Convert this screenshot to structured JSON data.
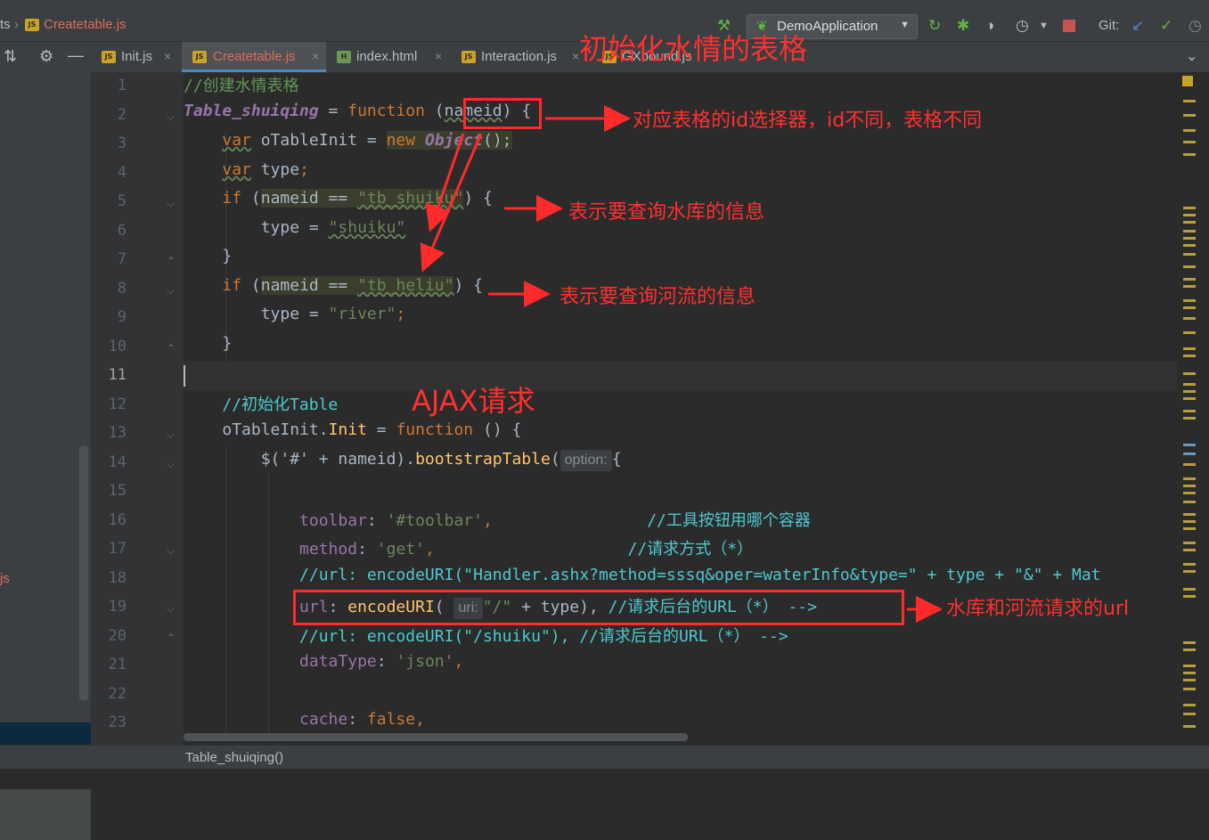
{
  "breadcrumb": {
    "prev": "ts",
    "file": "Createtable.js"
  },
  "run_config": {
    "label": "DemoApplication"
  },
  "git": {
    "label": "Git:"
  },
  "tabs": [
    {
      "label": "Init.js",
      "icon": "js-file-icon"
    },
    {
      "label": "Createtable.js",
      "icon": "js-file-icon",
      "active": true
    },
    {
      "label": "index.html",
      "icon": "html-file-icon"
    },
    {
      "label": "Interaction.js",
      "icon": "js-file-icon"
    },
    {
      "label": "GXbound.js",
      "icon": "js-file-icon"
    }
  ],
  "sidebar": {
    "file_fragment": "js"
  },
  "editor": {
    "line_numbers": [
      "1",
      "2",
      "3",
      "4",
      "5",
      "6",
      "7",
      "8",
      "9",
      "10",
      "11",
      "12",
      "13",
      "14",
      "15",
      "16",
      "17",
      "18",
      "19",
      "20",
      "21",
      "22",
      "23"
    ],
    "current_line": 11,
    "lines": {
      "l1": {
        "c": "//创建水情表格"
      },
      "l2": {
        "a": "Table_shuiqing",
        "b": " = ",
        "c": "function",
        "d": " (",
        "e": "nameid",
        "f": ") {"
      },
      "l3": {
        "a": "var",
        "b": " oTableInit = ",
        "c": "new ",
        "d": "Object",
        "e": "();"
      },
      "l4": {
        "a": "var",
        "b": " type",
        "c": ";"
      },
      "l5": {
        "a": "if",
        "b": " (",
        "c": "nameid == ",
        "d": "\"tb_shuiku\"",
        "e": ") {"
      },
      "l6": {
        "a": "type = ",
        "b": "\"shuiku\""
      },
      "l7": {
        "a": "}"
      },
      "l8": {
        "a": "if",
        "b": " (",
        "c": "nameid == ",
        "d": "\"tb_heliu\"",
        "e": ") {"
      },
      "l9": {
        "a": "type = ",
        "b": "\"river\"",
        "c": ";"
      },
      "l10": {
        "a": "}"
      },
      "l12": {
        "a": "//初始化Table"
      },
      "l13": {
        "a": "oTableInit.",
        "b": "Init",
        "c": " = ",
        "d": "function",
        "e": " () {"
      },
      "l14": {
        "a": "$('#' + nameid).",
        "b": "bootstrapTable",
        "c": "(",
        "hint": "option:",
        "d": "{"
      },
      "l16": {
        "a": "toolbar",
        "b": ": ",
        "c": "'#toolbar'",
        "d": ",",
        "e": "//工具按钮用哪个容器"
      },
      "l17": {
        "a": "method",
        "b": ": ",
        "c": "'get'",
        "d": ",",
        "e": "//请求方式（*）"
      },
      "l18": {
        "a": "//url: encodeURI(\"Handler.ashx?method=sssq&oper=waterInfo&type=\" + type + \"&\" + Mat"
      },
      "l19": {
        "a": "url",
        "b": ": ",
        "c": "encodeURI",
        "d": "( ",
        "hint": "uri:",
        "e": "\"/\"",
        "f": " + type), ",
        "g": "//请求后台的URL（*） -->"
      },
      "l20": {
        "a": "//url: encodeURI(\"/shuiku\"), //请求后台的URL（*） -->"
      },
      "l21": {
        "a": "dataType",
        "b": ": ",
        "c": "'json'",
        "d": ","
      },
      "l23": {
        "a": "cache",
        "b": ": ",
        "c": "false",
        "d": ","
      }
    }
  },
  "annotations": {
    "title": "初始化水情的表格",
    "id_note": "对应表格的id选择器，id不同，表格不同",
    "shuiku_note": "表示要查询水库的信息",
    "heliu_note": "表示要查询河流的信息",
    "ajax_note": "AJAX请求",
    "url_note": "水库和河流请求的url"
  },
  "status": {
    "breadcrumb": "Table_shuiqing()"
  },
  "colors": {
    "annotation": "#ff2a2a",
    "keyword": "#cc7832",
    "string": "#6a8759",
    "function": "#ffc66d",
    "comment": "#629755"
  }
}
